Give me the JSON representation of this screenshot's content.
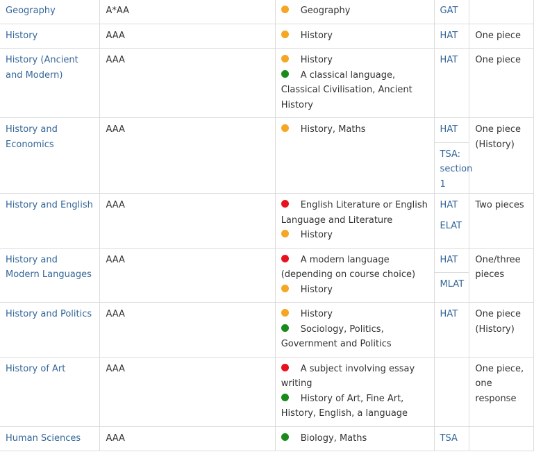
{
  "rows": [
    {
      "course": "Geography",
      "grades": "A*AA",
      "requirements": [
        {
          "dot": "orange",
          "text": "Geography"
        }
      ],
      "tests": [
        {
          "label": "GAT",
          "divider": false
        }
      ],
      "written": ""
    },
    {
      "course": "History",
      "grades": "AAA",
      "requirements": [
        {
          "dot": "orange",
          "text": "History"
        }
      ],
      "tests": [
        {
          "label": "HAT",
          "divider": false
        }
      ],
      "written": "One piece"
    },
    {
      "course": "History (Ancient and Modern)",
      "grades": "AAA",
      "requirements": [
        {
          "dot": "orange",
          "text": "History"
        },
        {
          "dot": "green",
          "text": "A classical language, Classical Civilisation, Ancient History"
        }
      ],
      "tests": [
        {
          "label": "HAT",
          "divider": false
        }
      ],
      "written": "One piece"
    },
    {
      "course": "History and Economics",
      "grades": "AAA",
      "requirements": [
        {
          "dot": "orange",
          "text": "History, Maths"
        }
      ],
      "tests": [
        {
          "label": "HAT",
          "divider": true
        },
        {
          "label": "TSA: section 1",
          "divider": false
        }
      ],
      "written": "One piece (History)"
    },
    {
      "course": "History and English",
      "grades": "AAA",
      "requirements": [
        {
          "dot": "red",
          "text": "English Literature or English Language and Literature"
        },
        {
          "dot": "orange",
          "text": "History"
        }
      ],
      "tests": [
        {
          "label": "HAT",
          "divider": false
        },
        {
          "label": "ELAT",
          "divider": false
        }
      ],
      "written": "Two pieces"
    },
    {
      "course": "History and Modern Languages",
      "grades": "AAA",
      "requirements": [
        {
          "dot": "red",
          "text": "A modern language (depending on course choice)"
        },
        {
          "dot": "orange",
          "text": "History"
        }
      ],
      "tests": [
        {
          "label": "HAT",
          "divider": true
        },
        {
          "label": "MLAT",
          "divider": false
        }
      ],
      "written": "One/three pieces"
    },
    {
      "course": "History and Politics",
      "grades": "AAA",
      "requirements": [
        {
          "dot": "orange",
          "text": "History"
        },
        {
          "dot": "green",
          "text": "Sociology, Politics, Government and Politics"
        }
      ],
      "tests": [
        {
          "label": "HAT",
          "divider": false
        }
      ],
      "written": "One piece (History)"
    },
    {
      "course": "History of Art",
      "grades": "AAA",
      "requirements": [
        {
          "dot": "red",
          "text": "A subject involving essay writing"
        },
        {
          "dot": "green",
          "text": "History of Art, Fine Art, History, English, a language"
        }
      ],
      "tests": [],
      "written": "One piece, one response"
    },
    {
      "course": "Human Sciences",
      "grades": "AAA",
      "requirements": [
        {
          "dot": "green",
          "text": "Biology, Maths"
        }
      ],
      "tests": [
        {
          "label": "TSA",
          "divider": false
        }
      ],
      "written": ""
    }
  ]
}
